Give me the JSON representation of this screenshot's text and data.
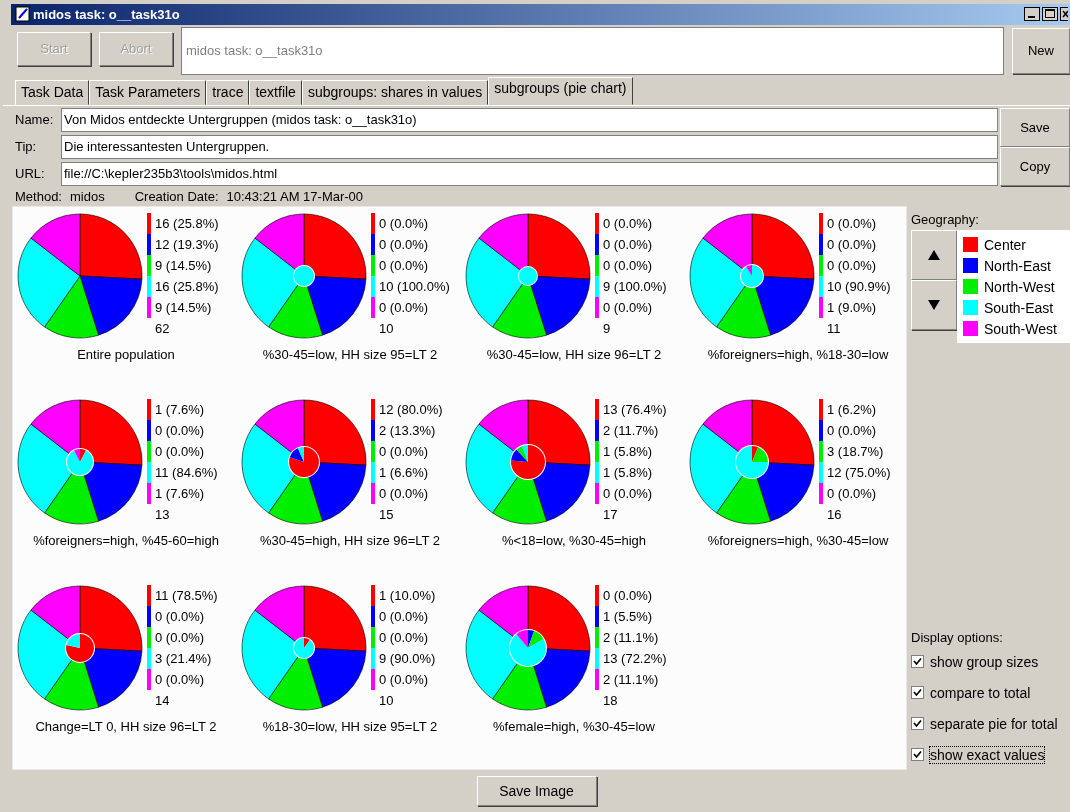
{
  "window": {
    "title": "midos task: o__task31o"
  },
  "toolbar": {
    "buttons": [
      {
        "label": "Start",
        "disabled": true
      },
      {
        "label": "Abort",
        "disabled": true
      }
    ],
    "task_field": {
      "value": "midos task: o__task31o",
      "disabled": true
    },
    "new_button": "New"
  },
  "tabs": [
    {
      "label": "Task Data",
      "selected": false
    },
    {
      "label": "Task Parameters",
      "selected": false
    },
    {
      "label": "trace",
      "selected": false
    },
    {
      "label": "textfile",
      "selected": false
    },
    {
      "label": "subgroups: shares in values",
      "selected": false
    },
    {
      "label": "subgroups (pie chart)",
      "selected": true
    }
  ],
  "fields": [
    {
      "label": "Name:",
      "value": "Von Midos entdeckte Untergruppen (midos task: o__task31o)"
    },
    {
      "label": "Tip:",
      "value": "Die interessantesten Untergruppen."
    },
    {
      "label": "URL:",
      "value": "file://C:\\kepler235b3\\tools\\midos.html"
    }
  ],
  "side_buttons": [
    "Save",
    "Copy"
  ],
  "info": {
    "method_label": "Method:",
    "method": "midos",
    "date_label": "Creation Date:",
    "date": "10:43:21 AM 17-Mar-00"
  },
  "pies": [
    {
      "title": "Entire population",
      "labels": [
        "16 (25.8%)",
        "12 (19.3%)",
        "9 (14.5%)",
        "16 (25.8%)",
        "9 (14.5%)"
      ],
      "size": "62"
    },
    {
      "title": "%30-45=low, HH size 95=LT 2",
      "labels": [
        "0 (0.0%)",
        "0 (0.0%)",
        "0 (0.0%)",
        "10 (100.0%)",
        "0 (0.0%)"
      ],
      "size": "10"
    },
    {
      "title": "%30-45=low, HH size 96=LT 2",
      "labels": [
        "0 (0.0%)",
        "0 (0.0%)",
        "0 (0.0%)",
        "9 (100.0%)",
        "0 (0.0%)"
      ],
      "size": "9"
    },
    {
      "title": "%foreigners=high, %18-30=low",
      "labels": [
        "0 (0.0%)",
        "0 (0.0%)",
        "0 (0.0%)",
        "10 (90.9%)",
        "1 (9.0%)"
      ],
      "size": "11"
    },
    {
      "title": "%foreigners=high, %45-60=high",
      "labels": [
        "1 (7.6%)",
        "0 (0.0%)",
        "0 (0.0%)",
        "11 (84.6%)",
        "1 (7.6%)"
      ],
      "size": "13"
    },
    {
      "title": "%30-45=high, HH size 96=LT 2",
      "labels": [
        "12 (80.0%)",
        "2 (13.3%)",
        "0 (0.0%)",
        "1 (6.6%)",
        "0 (0.0%)"
      ],
      "size": "15"
    },
    {
      "title": "%<18=low, %30-45=high",
      "labels": [
        "13 (76.4%)",
        "2 (11.7%)",
        "1 (5.8%)",
        "1 (5.8%)",
        "0 (0.0%)"
      ],
      "size": "17"
    },
    {
      "title": "%foreigners=high, %30-45=low",
      "labels": [
        "1 (6.2%)",
        "0 (0.0%)",
        "3 (18.7%)",
        "12 (75.0%)",
        "0 (0.0%)"
      ],
      "size": "16"
    },
    {
      "title": "Change=LT 0, HH size 96=LT 2",
      "labels": [
        "11 (78.5%)",
        "0 (0.0%)",
        "0 (0.0%)",
        "3 (21.4%)",
        "0 (0.0%)"
      ],
      "size": "14"
    },
    {
      "title": "%18-30=low, HH size 95=LT 2",
      "labels": [
        "1 (10.0%)",
        "0 (0.0%)",
        "0 (0.0%)",
        "9 (90.0%)",
        "0 (0.0%)"
      ],
      "size": "10"
    },
    {
      "title": "%female=high, %30-45=low",
      "labels": [
        "0 (0.0%)",
        "1 (5.5%)",
        "2 (11.1%)",
        "13 (72.2%)",
        "2 (11.1%)"
      ],
      "size": "18"
    }
  ],
  "geography": {
    "title": "Geography:",
    "items": [
      {
        "label": "Center",
        "color": "#ff0000"
      },
      {
        "label": "North-East",
        "color": "#0000ff"
      },
      {
        "label": "North-West",
        "color": "#00ee00"
      },
      {
        "label": "South-East",
        "color": "#00ffff"
      },
      {
        "label": "South-West",
        "color": "#ff00ff"
      }
    ]
  },
  "display_options": {
    "title": "Display options:",
    "items": [
      {
        "label": "show group sizes",
        "checked": true
      },
      {
        "label": "compare to total",
        "checked": true
      },
      {
        "label": "separate pie for total",
        "checked": true
      },
      {
        "label": "show exact values",
        "checked": true
      }
    ]
  },
  "save_image_button": "Save Image"
}
